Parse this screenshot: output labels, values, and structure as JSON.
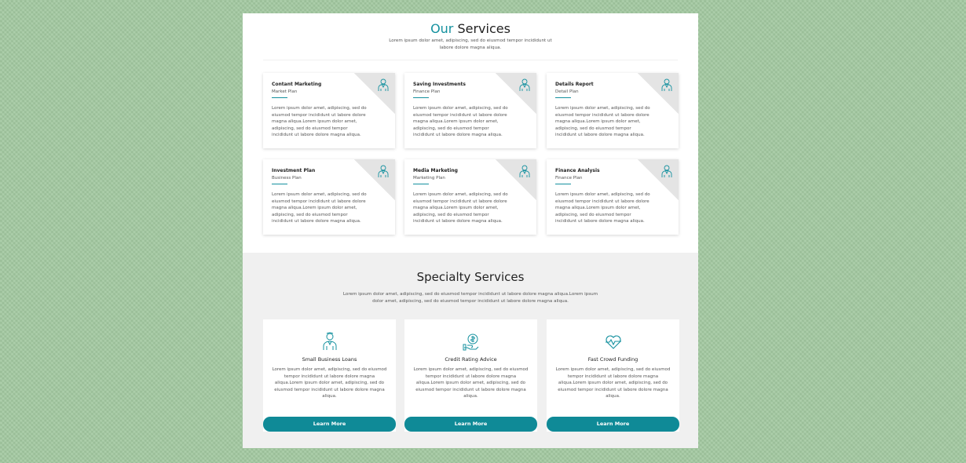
{
  "colors": {
    "accent": "#15919f",
    "button": "#0f8a97",
    "background": "#a3c9a1"
  },
  "our_services": {
    "title_accent": "Our",
    "title_rest": " Services",
    "desc_line1": "Lorem ipsum dolor amet, adipiscing, sed do eiusmod tempor incididunt ut",
    "desc_line2": "labore dolore magna aliqua.",
    "cards": [
      {
        "title": "Contant Marketing",
        "subtitle": "Market Plan",
        "icon": "doctor-icon",
        "text": "Lorem ipsum dolor amet, adipiscing, sed do eiusmod tempor incididunt ut labore dolore magna aliqua.Lorem ipsum dolor amet, adipiscing, sed do eiusmod tempor incididunt ut labore dolore magna aliqua."
      },
      {
        "title": "Saving Investments",
        "subtitle": "Finance Plan",
        "icon": "doctor-icon",
        "text": "Lorem ipsum dolor amet, adipiscing, sed do eiusmod tempor incididunt ut labore dolore magna aliqua.Lorem ipsum dolor amet, adipiscing, sed do eiusmod tempor incididunt ut labore dolore magna aliqua."
      },
      {
        "title": "Details Report",
        "subtitle": "Detail Plan",
        "icon": "doctor-icon",
        "text": "Lorem ipsum dolor amet, adipiscing, sed do eiusmod tempor incididunt ut labore dolore magna aliqua.Lorem ipsum dolor amet, adipiscing, sed do eiusmod tempor incididunt ut labore dolore magna aliqua."
      },
      {
        "title": "Investment Plan",
        "subtitle": "Business Plan",
        "icon": "doctor-icon",
        "text": "Lorem ipsum dolor amet, adipiscing, sed do eiusmod tempor incididunt ut labore dolore magna aliqua.Lorem ipsum dolor amet, adipiscing, sed do eiusmod tempor incididunt ut labore dolore magna aliqua."
      },
      {
        "title": "Media Marketing",
        "subtitle": "Marketing Plan",
        "icon": "doctor-icon",
        "text": "Lorem ipsum dolor amet, adipiscing, sed do eiusmod tempor incididunt ut labore dolore magna aliqua.Lorem ipsum dolor amet, adipiscing, sed do eiusmod tempor incididunt ut labore dolore magna aliqua."
      },
      {
        "title": "Finance Analysis",
        "subtitle": "Finance Plan",
        "icon": "doctor-icon",
        "text": "Lorem ipsum dolor amet, adipiscing, sed do eiusmod tempor incididunt ut labore dolore magna aliqua.Lorem ipsum dolor amet, adipiscing, sed do eiusmod tempor incididunt ut labore dolore magna aliqua."
      }
    ]
  },
  "specialty": {
    "title": "Specialty Services",
    "desc_line1": "Lorem ipsum dolor amet, adipiscing, sed do eiusmod tempor incididunt ut labore dolore magna aliqua.Lorem ipsum",
    "desc_line2": "dolor amet, adipiscing, sed do eiusmod tempor incididunt ut labore dolore magna aliqua.",
    "cards": [
      {
        "title": "Small Business Loans",
        "icon": "doctor-icon",
        "text": "Lorem ipsum dolor amet, adipiscing, sed do eiusmod tempor incididunt ut labore dolore magna aliqua.Lorem ipsum dolor amet, adipiscing, sed do eiusmod tempor incididunt ut labore dolore magna aliqua.",
        "button": "Learn More"
      },
      {
        "title": "Credit Rating Advice",
        "icon": "coin-hand-icon",
        "text": "Lorem ipsum dolor amet, adipiscing, sed do eiusmod tempor incididunt ut labore dolore magna aliqua.Lorem ipsum dolor amet, adipiscing, sed do eiusmod tempor incididunt ut labore dolore magna aliqua.",
        "button": "Learn More"
      },
      {
        "title": "Fast Crowd Funding",
        "icon": "heart-pulse-icon",
        "text": "Lorem ipsum dolor amet, adipiscing, sed do eiusmod tempor incididunt ut labore dolore magna aliqua.Lorem ipsum dolor amet, adipiscing, sed do eiusmod tempor incididunt ut labore dolore magna aliqua.",
        "button": "Learn More"
      }
    ]
  }
}
